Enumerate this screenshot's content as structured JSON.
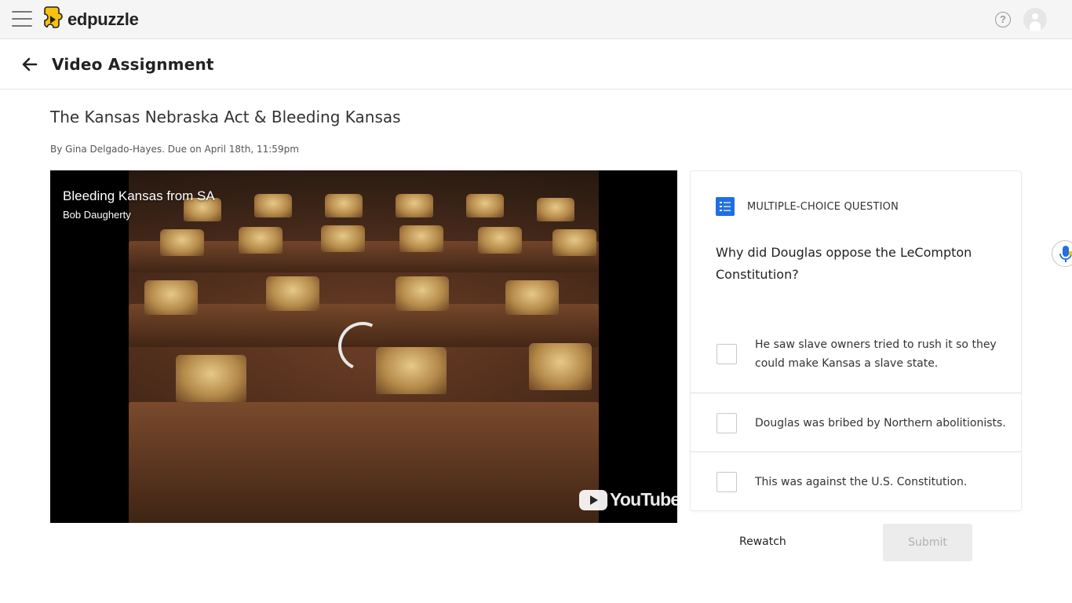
{
  "topbar": {
    "brand": "edpuzzle",
    "help_glyph": "?",
    "icons": [
      "hamburger-menu-icon",
      "edpuzzle-logo-icon",
      "help-icon",
      "avatar-icon"
    ]
  },
  "subheader": {
    "title": "Video Assignment",
    "back_icon": "arrow-left-icon"
  },
  "assignment": {
    "title": "The Kansas Nebraska Act & Bleeding Kansas",
    "meta": "By Gina Delgado-Hayes. Due on April 18th, 11:59pm"
  },
  "video": {
    "title": "Bleeding Kansas from SA",
    "channel": "Bob Daugherty",
    "provider": "YouTube",
    "state": "loading"
  },
  "question": {
    "type_label": "MULTIPLE-CHOICE QUESTION",
    "type_icon": "checklist-icon",
    "type_icon_color": "#1f6fe5",
    "text": "Why did Douglas oppose the LeCompton Constitution?",
    "options": [
      {
        "text": "He saw slave owners tried to rush it so they could make Kansas a slave state.",
        "checked": false
      },
      {
        "text": "Douglas was bribed by Northern abolitionists.",
        "checked": false
      },
      {
        "text": "This was against the U.S. Constitution.",
        "checked": false
      }
    ]
  },
  "actions": {
    "rewatch_label": "Rewatch",
    "submit_label": "Submit",
    "submit_enabled": false
  },
  "side": {
    "mic_icon": "microphone-icon"
  },
  "colors": {
    "brand_yellow": "#f5c211",
    "accent_blue": "#1f6fe5",
    "topbar_bg": "#f5f5f5"
  }
}
